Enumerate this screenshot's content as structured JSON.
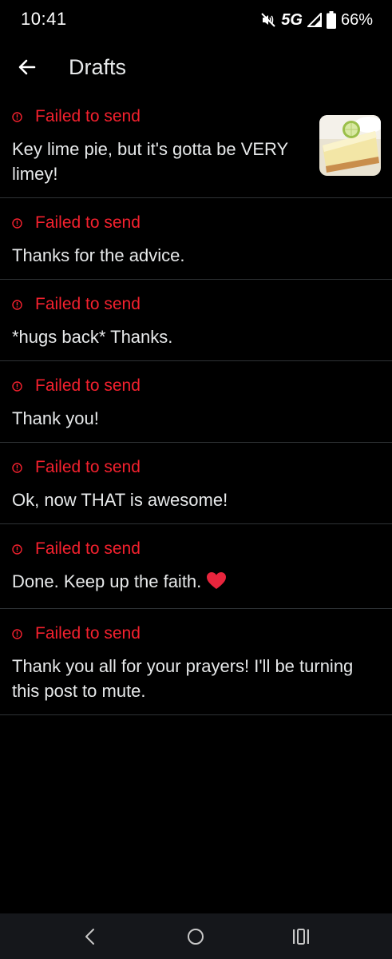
{
  "status_bar": {
    "time": "10:41",
    "network": "5G",
    "battery": "66%",
    "icons": [
      "mute-icon",
      "signal-icon",
      "battery-icon"
    ]
  },
  "header": {
    "title": "Drafts",
    "back_icon": "arrow-left-icon"
  },
  "drafts": [
    {
      "status": "Failed to send",
      "text": "Key lime pie, but it's gotta be VERY limey!",
      "thumbnail": "key-lime-pie-image"
    },
    {
      "status": "Failed to send",
      "text": "Thanks for the advice."
    },
    {
      "status": "Failed to send",
      "text": "*hugs back* Thanks."
    },
    {
      "status": "Failed to send",
      "text": "Thank you!"
    },
    {
      "status": "Failed to send",
      "text": "Ok, now THAT is awesome!"
    },
    {
      "status": "Failed to send",
      "text": "Done. Keep up the faith.",
      "emoji": "heart-icon"
    },
    {
      "status": "Failed to send",
      "text": "Thank you all for your prayers! I'll be turning this post to mute."
    }
  ],
  "nav_bar": {
    "icons": [
      "back-nav-icon",
      "home-nav-icon",
      "recents-nav-icon"
    ]
  },
  "colors": {
    "background": "#000000",
    "error": "#f4212e",
    "text": "#e7e9ea",
    "divider": "#2f3336",
    "nav_bar": "#15171b"
  }
}
